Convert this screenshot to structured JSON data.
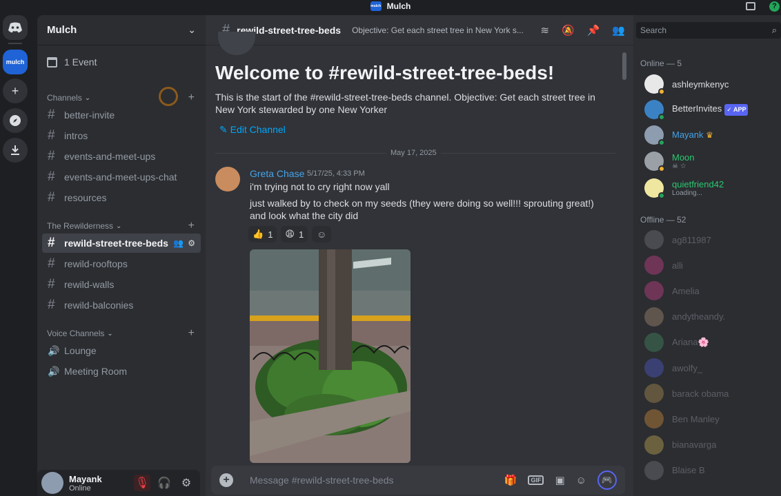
{
  "window": {
    "title": "Mulch",
    "server_logo_text": "mulch"
  },
  "rail": {
    "server_label": "mulch"
  },
  "server": {
    "name": "Mulch",
    "event_label": "1 Event",
    "categories": [
      {
        "label": "Channels"
      },
      {
        "label": "The Rewilderness"
      },
      {
        "label": "Voice Channels"
      }
    ],
    "channels": [
      {
        "label": "better-invite"
      },
      {
        "label": "intros"
      },
      {
        "label": "events-and-meet-ups"
      },
      {
        "label": "events-and-meet-ups-chat"
      },
      {
        "label": "resources"
      },
      {
        "label": "rewild-street-tree-beds"
      },
      {
        "label": "rewild-rooftops"
      },
      {
        "label": "rewild-walls"
      },
      {
        "label": "rewild-balconies"
      }
    ],
    "voice_channels": [
      {
        "label": "Lounge"
      },
      {
        "label": "Meeting Room"
      }
    ]
  },
  "user": {
    "name": "Mayank",
    "status": "Online"
  },
  "channel": {
    "name": "rewild-street-tree-beds",
    "topic": "Objective: Get each street tree in New York s...",
    "welcome_title": "Welcome to #rewild-street-tree-beds!",
    "welcome_desc": "This is the start of the #rewild-street-tree-beds channel. Objective: Get each street tree in New York stewarded by one New Yorker",
    "edit_label": "Edit Channel",
    "divider_date": "May 17, 2025"
  },
  "message": {
    "author": "Greta Chase",
    "timestamp": "5/17/25, 4:33 PM",
    "lines": [
      "i'm trying not to cry right now yall",
      "just walked by to check on my seeds (they were doing so well!!! sprouting great!) and look what the city did"
    ],
    "reactions": [
      {
        "emoji": "👍",
        "count": "1"
      },
      {
        "emoji": "😩",
        "count": "1"
      }
    ]
  },
  "composer": {
    "placeholder": "Message #rewild-street-tree-beds",
    "gif_label": "GIF"
  },
  "members": {
    "search_placeholder": "Search",
    "online_header": "Online — 5",
    "offline_header": "Offline — 52",
    "online": [
      {
        "name": "ashleymkenyc",
        "sub": "",
        "color": "#dbdee1",
        "avatar": "#e8e8e8",
        "status": "#f0b232"
      },
      {
        "name": "BetterInvites",
        "sub": "",
        "color": "#dbdee1",
        "avatar": "#3b82c4",
        "status": "#23a55a",
        "app_tag": "✓ APP"
      },
      {
        "name": "Mayank",
        "sub": "",
        "color": "#45a3e8",
        "avatar": "#8d9cae",
        "status": "#23a55a",
        "crown": "♛"
      },
      {
        "name": "Moon",
        "sub": "☠ ☆",
        "color": "#2dc770",
        "avatar": "#9aa0a6",
        "status": "#f0b232"
      },
      {
        "name": "quietfriend42",
        "sub": "Loading...",
        "color": "#2dc770",
        "avatar": "#efe6a0",
        "status": "#23a55a"
      }
    ],
    "offline": [
      {
        "name": "ag811987",
        "avatar": "#80848e"
      },
      {
        "name": "alli",
        "avatar": "#eb459e"
      },
      {
        "name": "Amelia",
        "avatar": "#eb459e"
      },
      {
        "name": "andytheandy.",
        "avatar": "#c0a080"
      },
      {
        "name": "Ariana🌸",
        "avatar": "#4a9e6e"
      },
      {
        "name": "awolfy_",
        "avatar": "#5865f2"
      },
      {
        "name": "barack obama",
        "avatar": "#c8a25a"
      },
      {
        "name": "Ben Manley",
        "avatar": "#f0a040"
      },
      {
        "name": "bianavarga",
        "avatar": "#e6c25a"
      },
      {
        "name": "Blaise B",
        "avatar": "#80848e"
      }
    ]
  }
}
